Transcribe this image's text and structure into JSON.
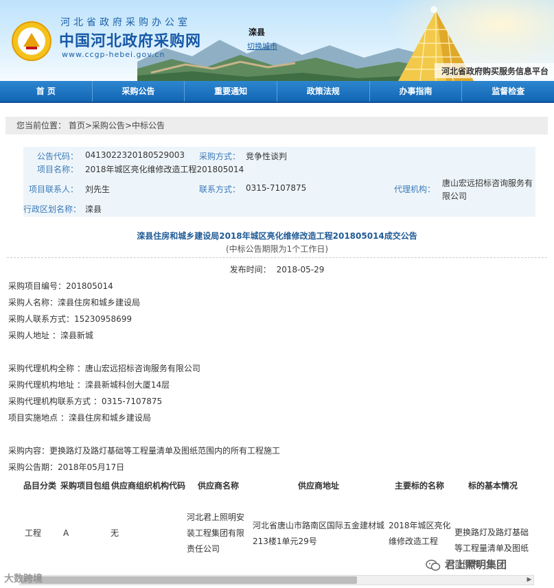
{
  "header": {
    "office_name": "河北省政府采购办公室",
    "site_name": "中国河北政府采购网",
    "site_url": "www.ccgp-hebei.gov.cn",
    "city": "滦县",
    "switch_city": "切换城市",
    "platform_tag": "河北省政府购买服务信息平台"
  },
  "nav": [
    "首 页",
    "采购公告",
    "重要通知",
    "政策法规",
    "办事指南",
    "监督检查"
  ],
  "breadcrumb": {
    "prefix": "您当前位置：",
    "home": "首页",
    "sep1": ">",
    "section": "采购公告",
    "sep2": ">",
    "current": "中标公告"
  },
  "info": {
    "code_label": "公告代码：",
    "code_value": "0413022320180529003",
    "method_label": "采购方式：",
    "method_value": "竞争性谈判",
    "project_label": "项目名称：",
    "project_value": "2018年城区亮化维修改造工程201805014",
    "contact_label": "项目联系人：",
    "contact_value": "刘先生",
    "phone_label": "联系方式：",
    "phone_value": "0315-7107875",
    "agency_label": "代理机构：",
    "agency_value": "唐山宏远招标咨询服务有限公司",
    "region_label": "行政区划名称：",
    "region_value": "滦县"
  },
  "article": {
    "title": "滦县住房和城乡建设局2018年城区亮化维修改造工程201805014成交公告",
    "subtitle": "(中标公告期限为1个工作日)",
    "publish_label": "发布时间：",
    "publish_time": "2018-05-29",
    "lines": [
      "采购项目编号：201805014",
      "采购人名称：滦县住房和城乡建设局",
      "采购人联系方式：15230958699",
      "采购人地址 ：滦县新城",
      "采购代理机构全称 ：唐山宏远招标咨询服务有限公司",
      "采购代理机构地址 ：滦县新城科创大厦14层",
      "采购代理机构联系方式 ：0315-7107875",
      "项目实施地点 ：滦县住房和城乡建设局",
      "采购内容：更换路灯及路灯基础等工程量清单及图纸范围内的所有工程施工",
      "采购公告期：2018年05月17日"
    ]
  },
  "table": {
    "headers": [
      "品目分类",
      "采购项目包组",
      "供应商组织机构代码",
      "供应商名称",
      "供应商地址",
      "主要标的名称",
      "标的基本情况"
    ],
    "row": [
      "工程",
      "A",
      "无",
      "河北君上照明安装工程集团有限责任公司",
      "河北省唐山市路南区国际五金建材城213楼1单元29号",
      "2018年城区亮化维修改造工程",
      "更换路灯及路灯基础等工程量清单及图纸范围内"
    ]
  },
  "watermarks": {
    "left": "大数跨境",
    "right": "君上照明集团"
  },
  "colors": {
    "nav_blue": "#1b6fbf",
    "label_blue": "#3a7ab8",
    "title_blue": "#1e5a96",
    "info_bg": "#eef5fa"
  }
}
